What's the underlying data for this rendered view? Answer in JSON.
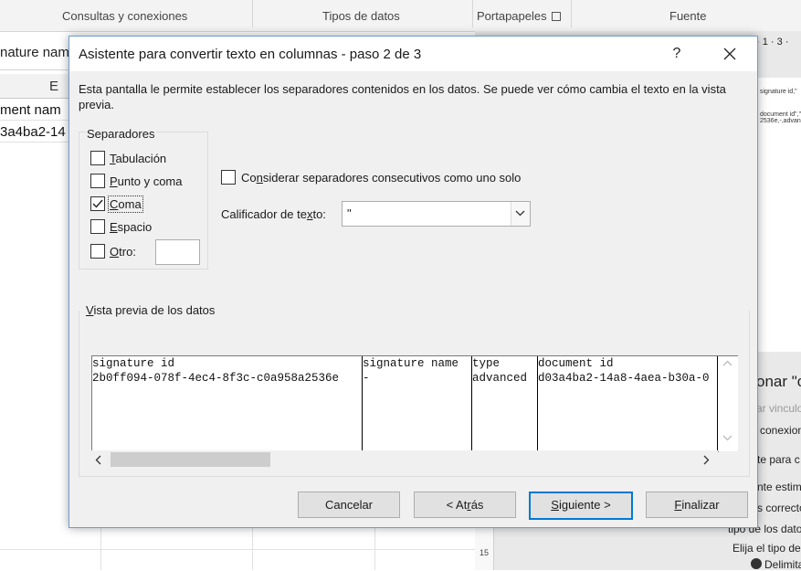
{
  "background": {
    "ribbon_groups": [
      "Consultas y conexiones",
      "Tipos de datos",
      "Portapapeles",
      "Fuente"
    ],
    "formula_text": "nature nam",
    "column_letter": "E",
    "cell_e1": "ment nam",
    "cell_e2": "3a4ba2-14",
    "doc_preview_lines": [
      "signature id,\"",
      "document id\",\"d",
      "2536e,-,advanced"
    ],
    "ruler_number": "· 1 · 3 ·",
    "ruler_vertical": "15",
    "side_texts": [
      "onar \"c",
      "ar vinculo",
      "conexione",
      "te para c",
      "nte estima",
      "s correcto",
      "tipo de los dato",
      "Elija el tipo de a",
      "Delimita"
    ]
  },
  "dialog": {
    "title": "Asistente para convertir texto en columnas - paso 2 de 3",
    "help": "?",
    "description": "Esta pantalla le permite establecer los separadores contenidos en los datos. Se puede ver cómo cambia el texto en la vista previa.",
    "separators": {
      "label": "Separadores",
      "options": [
        {
          "pre": "",
          "key": "T",
          "post": "abulación",
          "checked": false
        },
        {
          "pre": "",
          "key": "P",
          "post": "unto y coma",
          "checked": false
        },
        {
          "pre": "",
          "key": "C",
          "post": "oma",
          "checked": true
        },
        {
          "pre": "",
          "key": "E",
          "post": "spacio",
          "checked": false
        },
        {
          "pre": "",
          "key": "O",
          "post": "tro:",
          "checked": false
        }
      ],
      "otro_value": ""
    },
    "consecutive": {
      "pre": "Co",
      "key": "n",
      "post": "siderar separadores consecutivos como uno solo",
      "checked": false
    },
    "qualifier": {
      "pre": "Calificador de te",
      "key": "x",
      "post": "to:",
      "value": "\""
    },
    "preview": {
      "label_key": "V",
      "label_rest": "ista previa de los datos",
      "columns": [
        [
          "signature id",
          "2b0ff094-078f-4ec4-8f3c-c0a958a2536e"
        ],
        [
          "signature name",
          "-"
        ],
        [
          "type",
          "advanced"
        ],
        [
          "document id",
          "d03a4ba2-14a8-4aea-b30a-0"
        ]
      ]
    },
    "buttons": {
      "cancel": "Cancelar",
      "back_pre": "< At",
      "back_key": "r",
      "back_post": "ás",
      "next_pre": "",
      "next_key": "S",
      "next_post": "iguiente >",
      "finish_pre": "",
      "finish_key": "F",
      "finish_post": "inalizar"
    }
  }
}
